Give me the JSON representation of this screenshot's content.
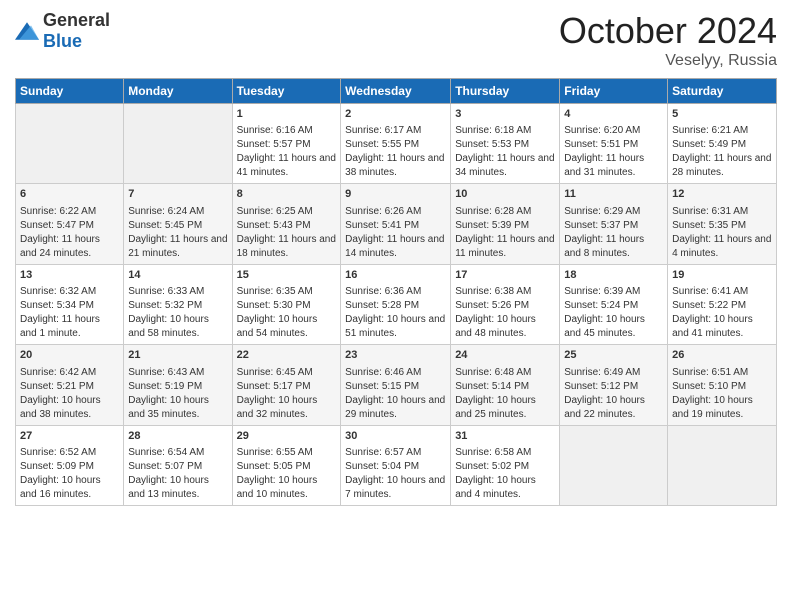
{
  "header": {
    "logo_general": "General",
    "logo_blue": "Blue",
    "month_title": "October 2024",
    "location": "Veselyy, Russia"
  },
  "days_of_week": [
    "Sunday",
    "Monday",
    "Tuesday",
    "Wednesday",
    "Thursday",
    "Friday",
    "Saturday"
  ],
  "weeks": [
    [
      {
        "day": "",
        "content": ""
      },
      {
        "day": "",
        "content": ""
      },
      {
        "day": "1",
        "content": "Sunrise: 6:16 AM\nSunset: 5:57 PM\nDaylight: 11 hours and 41 minutes."
      },
      {
        "day": "2",
        "content": "Sunrise: 6:17 AM\nSunset: 5:55 PM\nDaylight: 11 hours and 38 minutes."
      },
      {
        "day": "3",
        "content": "Sunrise: 6:18 AM\nSunset: 5:53 PM\nDaylight: 11 hours and 34 minutes."
      },
      {
        "day": "4",
        "content": "Sunrise: 6:20 AM\nSunset: 5:51 PM\nDaylight: 11 hours and 31 minutes."
      },
      {
        "day": "5",
        "content": "Sunrise: 6:21 AM\nSunset: 5:49 PM\nDaylight: 11 hours and 28 minutes."
      }
    ],
    [
      {
        "day": "6",
        "content": "Sunrise: 6:22 AM\nSunset: 5:47 PM\nDaylight: 11 hours and 24 minutes."
      },
      {
        "day": "7",
        "content": "Sunrise: 6:24 AM\nSunset: 5:45 PM\nDaylight: 11 hours and 21 minutes."
      },
      {
        "day": "8",
        "content": "Sunrise: 6:25 AM\nSunset: 5:43 PM\nDaylight: 11 hours and 18 minutes."
      },
      {
        "day": "9",
        "content": "Sunrise: 6:26 AM\nSunset: 5:41 PM\nDaylight: 11 hours and 14 minutes."
      },
      {
        "day": "10",
        "content": "Sunrise: 6:28 AM\nSunset: 5:39 PM\nDaylight: 11 hours and 11 minutes."
      },
      {
        "day": "11",
        "content": "Sunrise: 6:29 AM\nSunset: 5:37 PM\nDaylight: 11 hours and 8 minutes."
      },
      {
        "day": "12",
        "content": "Sunrise: 6:31 AM\nSunset: 5:35 PM\nDaylight: 11 hours and 4 minutes."
      }
    ],
    [
      {
        "day": "13",
        "content": "Sunrise: 6:32 AM\nSunset: 5:34 PM\nDaylight: 11 hours and 1 minute."
      },
      {
        "day": "14",
        "content": "Sunrise: 6:33 AM\nSunset: 5:32 PM\nDaylight: 10 hours and 58 minutes."
      },
      {
        "day": "15",
        "content": "Sunrise: 6:35 AM\nSunset: 5:30 PM\nDaylight: 10 hours and 54 minutes."
      },
      {
        "day": "16",
        "content": "Sunrise: 6:36 AM\nSunset: 5:28 PM\nDaylight: 10 hours and 51 minutes."
      },
      {
        "day": "17",
        "content": "Sunrise: 6:38 AM\nSunset: 5:26 PM\nDaylight: 10 hours and 48 minutes."
      },
      {
        "day": "18",
        "content": "Sunrise: 6:39 AM\nSunset: 5:24 PM\nDaylight: 10 hours and 45 minutes."
      },
      {
        "day": "19",
        "content": "Sunrise: 6:41 AM\nSunset: 5:22 PM\nDaylight: 10 hours and 41 minutes."
      }
    ],
    [
      {
        "day": "20",
        "content": "Sunrise: 6:42 AM\nSunset: 5:21 PM\nDaylight: 10 hours and 38 minutes."
      },
      {
        "day": "21",
        "content": "Sunrise: 6:43 AM\nSunset: 5:19 PM\nDaylight: 10 hours and 35 minutes."
      },
      {
        "day": "22",
        "content": "Sunrise: 6:45 AM\nSunset: 5:17 PM\nDaylight: 10 hours and 32 minutes."
      },
      {
        "day": "23",
        "content": "Sunrise: 6:46 AM\nSunset: 5:15 PM\nDaylight: 10 hours and 29 minutes."
      },
      {
        "day": "24",
        "content": "Sunrise: 6:48 AM\nSunset: 5:14 PM\nDaylight: 10 hours and 25 minutes."
      },
      {
        "day": "25",
        "content": "Sunrise: 6:49 AM\nSunset: 5:12 PM\nDaylight: 10 hours and 22 minutes."
      },
      {
        "day": "26",
        "content": "Sunrise: 6:51 AM\nSunset: 5:10 PM\nDaylight: 10 hours and 19 minutes."
      }
    ],
    [
      {
        "day": "27",
        "content": "Sunrise: 6:52 AM\nSunset: 5:09 PM\nDaylight: 10 hours and 16 minutes."
      },
      {
        "day": "28",
        "content": "Sunrise: 6:54 AM\nSunset: 5:07 PM\nDaylight: 10 hours and 13 minutes."
      },
      {
        "day": "29",
        "content": "Sunrise: 6:55 AM\nSunset: 5:05 PM\nDaylight: 10 hours and 10 minutes."
      },
      {
        "day": "30",
        "content": "Sunrise: 6:57 AM\nSunset: 5:04 PM\nDaylight: 10 hours and 7 minutes."
      },
      {
        "day": "31",
        "content": "Sunrise: 6:58 AM\nSunset: 5:02 PM\nDaylight: 10 hours and 4 minutes."
      },
      {
        "day": "",
        "content": ""
      },
      {
        "day": "",
        "content": ""
      }
    ]
  ]
}
